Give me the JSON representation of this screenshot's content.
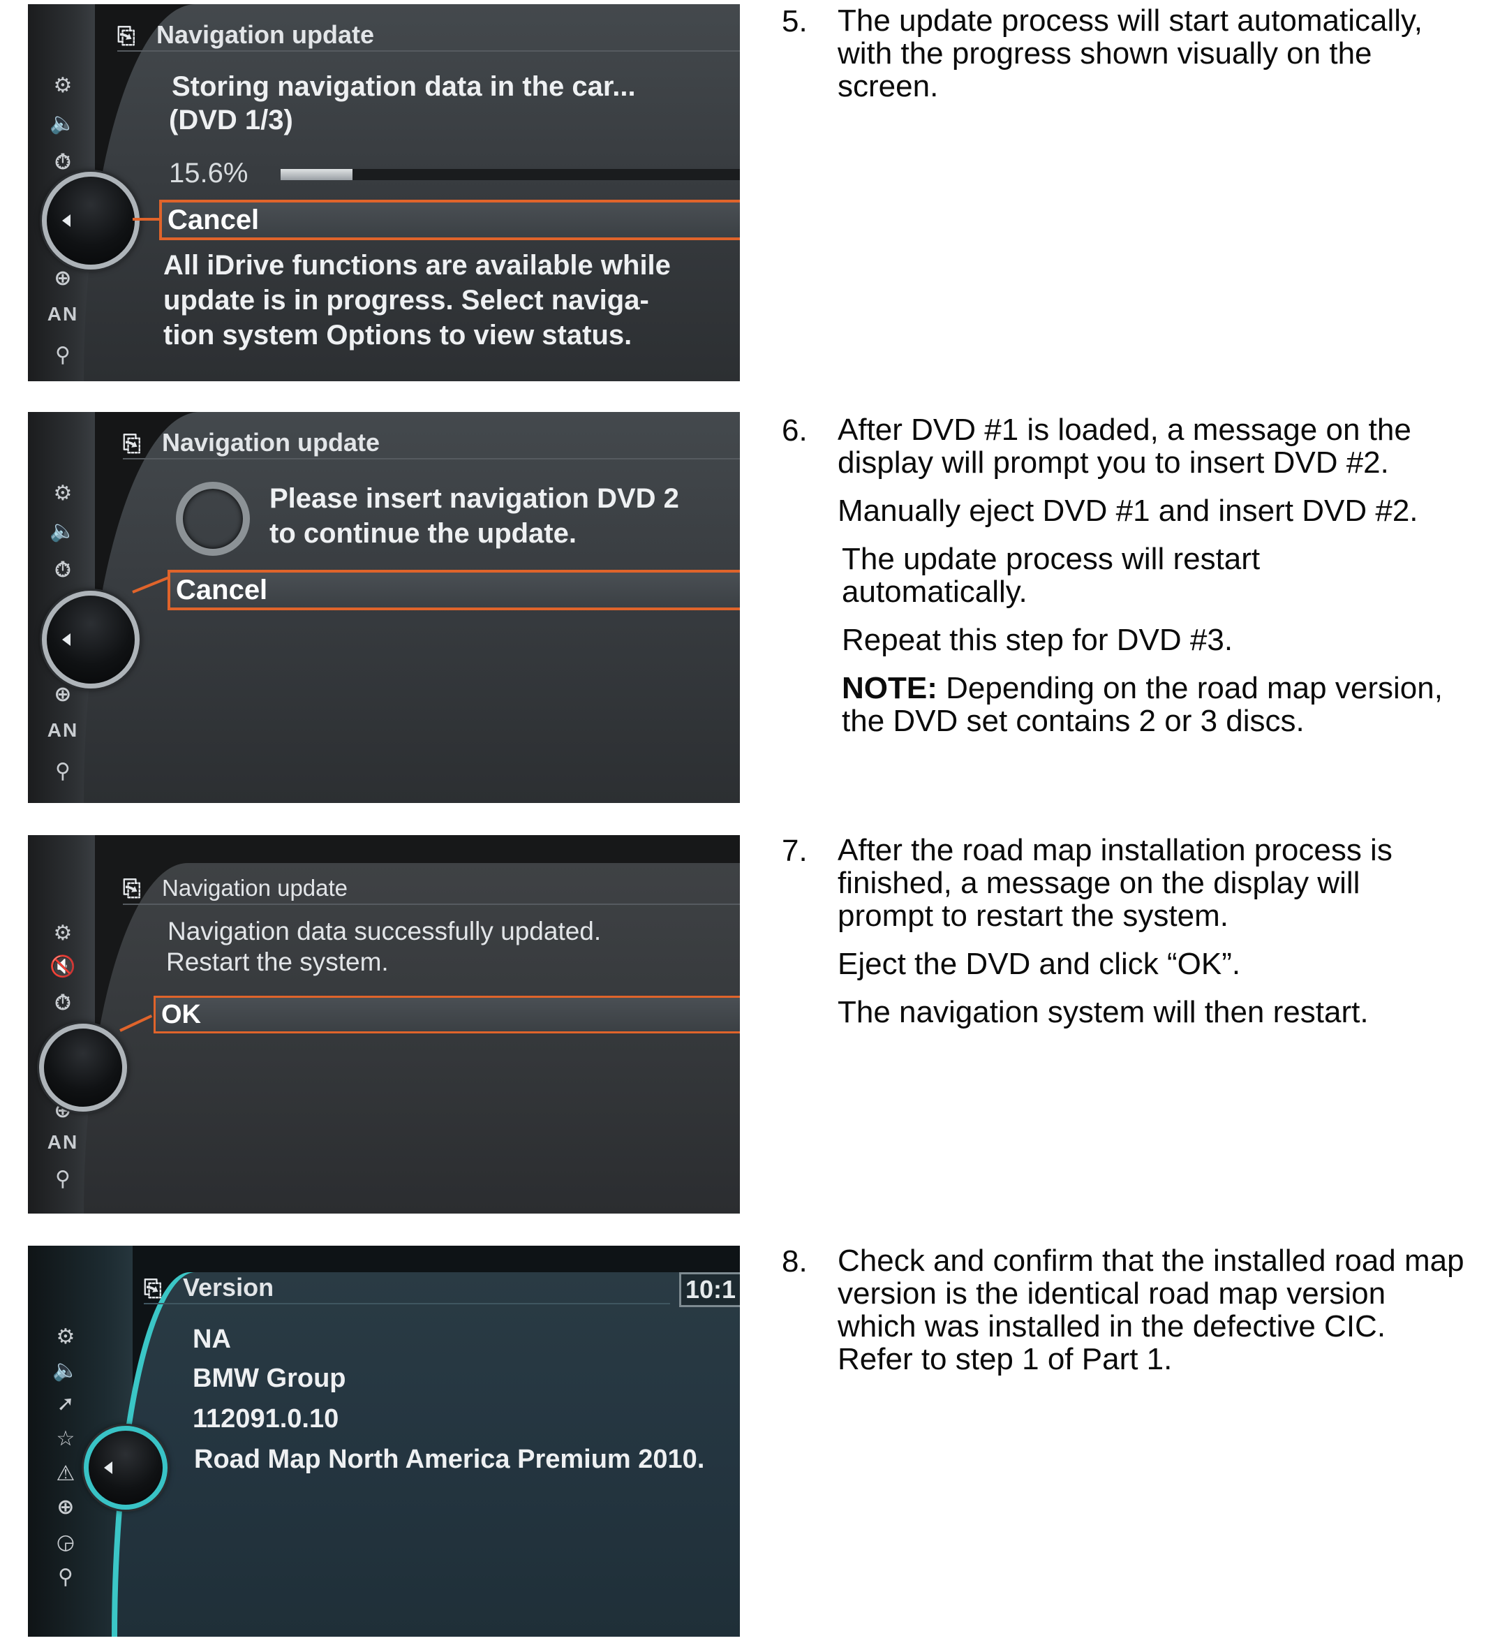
{
  "screens": [
    {
      "title": "Navigation update",
      "line1": "Storing navigation data in the car...",
      "line2": "(DVD 1/3)",
      "progress_text": "15.6%",
      "progress_value": 15.6,
      "button": "Cancel",
      "info1": "All iDrive functions are available while",
      "info2": "update is in progress. Select naviga-",
      "info3": "tion system Options to view status."
    },
    {
      "title": "Navigation update",
      "line1": "Please insert navigation DVD 2",
      "line2": "to continue the update.",
      "button": "Cancel"
    },
    {
      "title": "Navigation update",
      "line1": "Navigation data successfully updated.",
      "line2": "Restart the system.",
      "button": "OK"
    },
    {
      "title": "Version",
      "clock": "10:1",
      "items": [
        "NA",
        "BMW Group",
        "112091.0.10",
        "Road Map North America Premium 2010."
      ]
    }
  ],
  "rail_labels": {
    "an": "AN"
  },
  "steps": {
    "s5": {
      "num": "5.",
      "p1": "The update process will start automatically, with the progress shown visually on the screen."
    },
    "s6": {
      "num": "6.",
      "p1": "After DVD #1 is loaded, a message on the display will prompt you to insert DVD #2.",
      "p2": "Manually eject DVD #1 and insert DVD #2.",
      "p3": "The update process will restart automatically.",
      "p4": "Repeat this step for DVD #3.",
      "note_label": "NOTE:",
      "note_text": " Depending on the road map version, the DVD set contains 2 or 3 discs."
    },
    "s7": {
      "num": "7.",
      "p1": "After the road map installation process is finished, a message on the display will prompt to restart the system.",
      "p2": "Eject the DVD and click “OK”.",
      "p3": "The navigation system will then restart."
    },
    "s8": {
      "num": "8.",
      "p1": "Check and confirm that the installed road map version is the identical road map version which was installed in the defective CIC. Refer to step 1 of Part 1."
    }
  },
  "colors": {
    "highlight": "#e0642b",
    "accent_teal": "#3bc6c6"
  },
  "icons": [
    "nav-update-icon",
    "settings-icon",
    "speaker-icon",
    "timer-icon",
    "compass-icon",
    "search-icon",
    "spinner-icon",
    "controller-knob-icon"
  ]
}
